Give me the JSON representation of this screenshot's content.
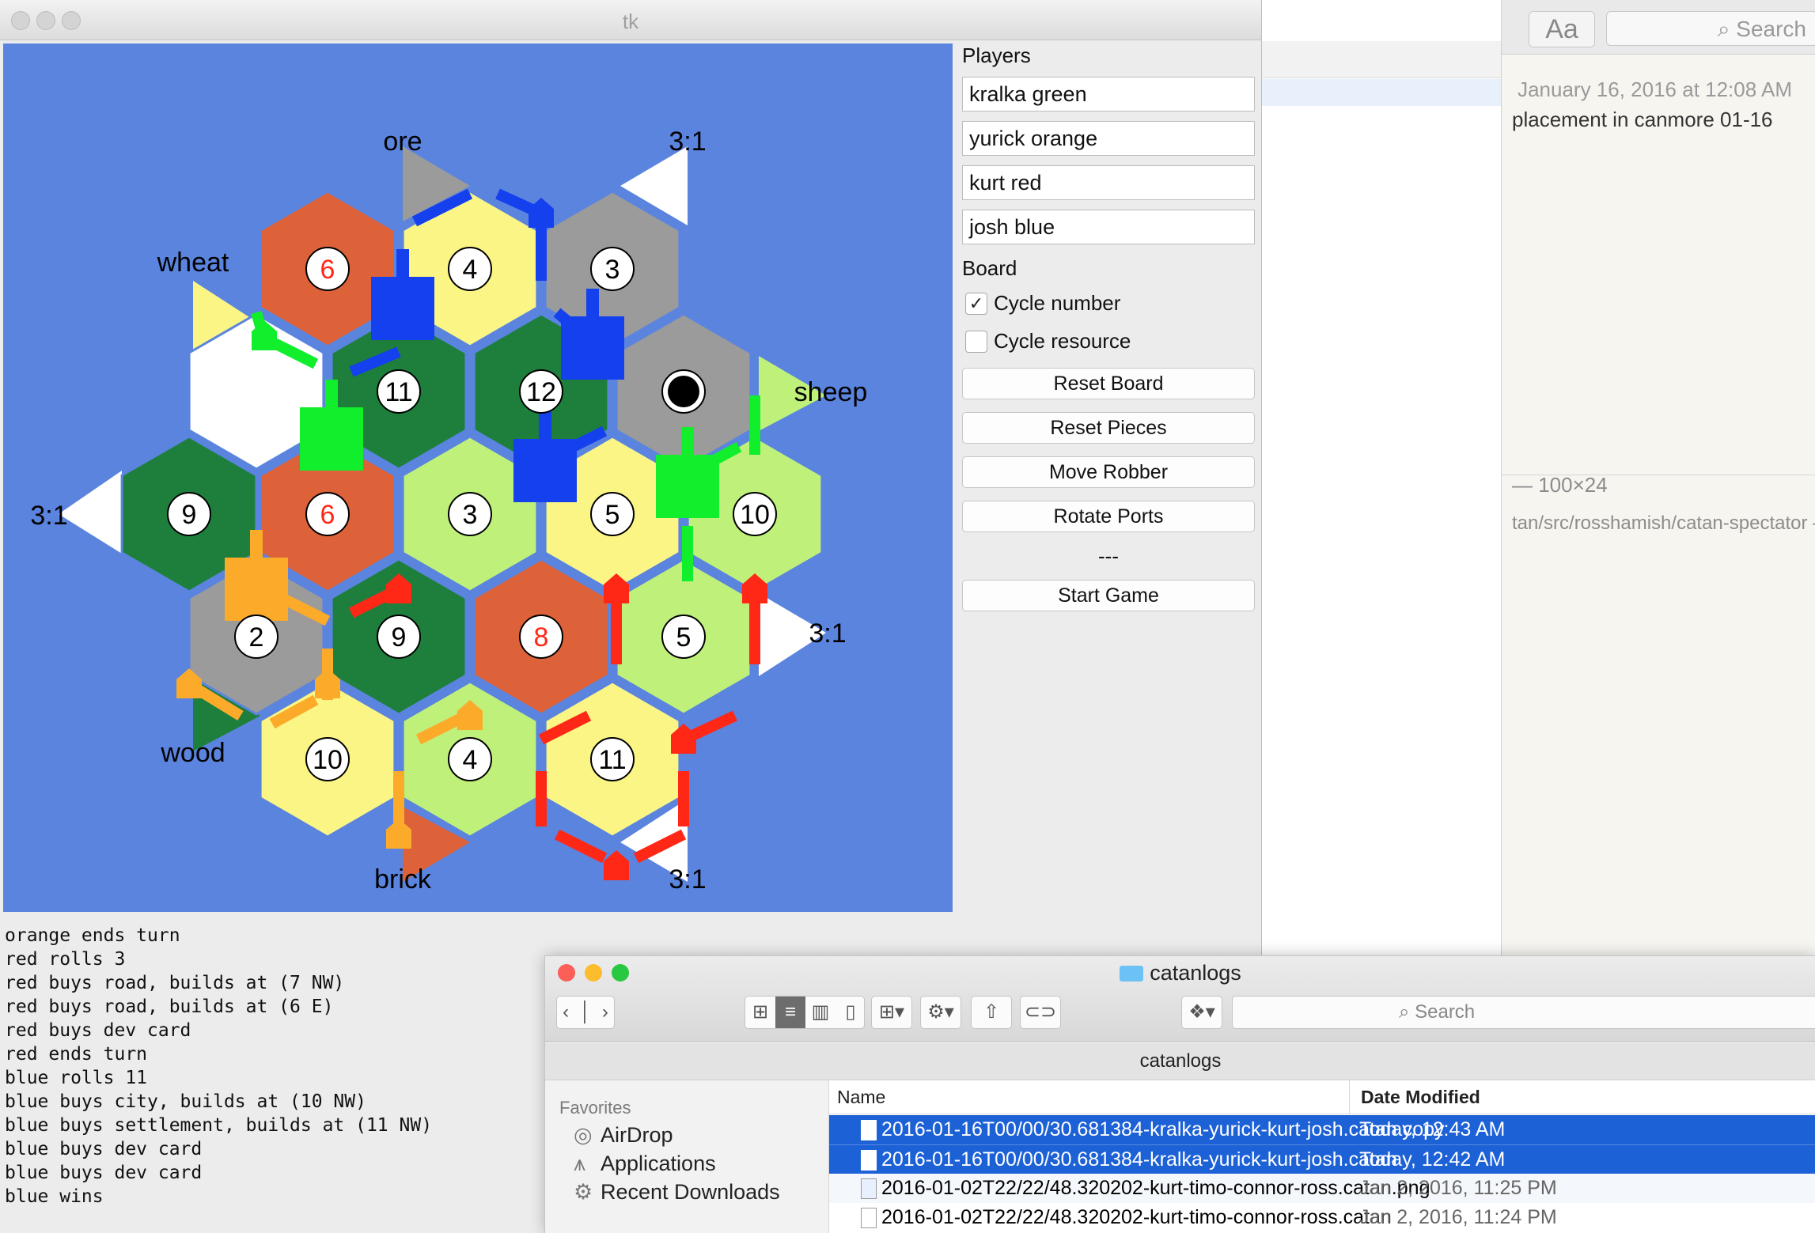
{
  "notes": {
    "font_button": "Aa",
    "search_placeholder": "Search",
    "date": "January 16, 2016 at 12:08 AM",
    "title_fragment": "placement in canmore 01-16",
    "dims": "— 100×24",
    "path_fragment": "tan/src/rosshamish/catan-spectator —"
  },
  "tk": {
    "title": "tk",
    "players_label": "Players",
    "players": [
      "kralka green",
      "yurick orange",
      "kurt red",
      "josh blue"
    ],
    "board_label": "Board",
    "cycle_number": {
      "label": "Cycle number",
      "checked": true
    },
    "cycle_resource": {
      "label": "Cycle resource",
      "checked": false
    },
    "buttons": {
      "reset_board": "Reset Board",
      "reset_pieces": "Reset Pieces",
      "move_robber": "Move Robber",
      "rotate_ports": "Rotate Ports",
      "separator": "---",
      "start_game": "Start Game"
    },
    "log": [
      "orange ends turn",
      "red rolls 3",
      "red buys road, builds at (7 NW)",
      "red buys road, builds at (6 E)",
      "red buys dev card",
      "red ends turn",
      "blue rolls 11",
      "blue buys city, builds at (10 NW)",
      "blue buys settlement, builds at (11 NW)",
      "blue buys dev card",
      "blue buys dev card",
      "blue wins"
    ]
  },
  "board": {
    "colors": {
      "ocean": "#5a84de",
      "wheat": "#fbf586",
      "sheep": "#bff07a",
      "wood": "#1e7f3c",
      "brick": "#dd6239",
      "ore": "#9b9b9b",
      "desert": "#ffffff",
      "green_player": "#10ee2c",
      "orange_player": "#fbaa2a",
      "red_player": "#ff2716",
      "blue_player": "#1440ee"
    },
    "tiles": [
      {
        "row": 0,
        "col": 0,
        "terrain": "brick",
        "number": "6",
        "hot": true
      },
      {
        "row": 0,
        "col": 1,
        "terrain": "wheat",
        "number": "4"
      },
      {
        "row": 0,
        "col": 2,
        "terrain": "ore",
        "number": "3"
      },
      {
        "row": 1,
        "col": 0,
        "terrain": "desert",
        "number": ""
      },
      {
        "row": 1,
        "col": 1,
        "terrain": "wood",
        "number": "11"
      },
      {
        "row": 1,
        "col": 2,
        "terrain": "wood",
        "number": "12"
      },
      {
        "row": 1,
        "col": 3,
        "terrain": "ore",
        "number": "",
        "robber": true
      },
      {
        "row": 2,
        "col": 0,
        "terrain": "wood",
        "number": "9"
      },
      {
        "row": 2,
        "col": 1,
        "terrain": "brick",
        "number": "6",
        "hot": true
      },
      {
        "row": 2,
        "col": 2,
        "terrain": "sheep",
        "number": "3"
      },
      {
        "row": 2,
        "col": 3,
        "terrain": "wheat",
        "number": "5"
      },
      {
        "row": 2,
        "col": 4,
        "terrain": "sheep",
        "number": "10"
      },
      {
        "row": 3,
        "col": 0,
        "terrain": "ore",
        "number": "2"
      },
      {
        "row": 3,
        "col": 1,
        "terrain": "wood",
        "number": "9"
      },
      {
        "row": 3,
        "col": 2,
        "terrain": "brick",
        "number": "8",
        "hot": true
      },
      {
        "row": 3,
        "col": 3,
        "terrain": "sheep",
        "number": "5"
      },
      {
        "row": 4,
        "col": 0,
        "terrain": "wheat",
        "number": "10"
      },
      {
        "row": 4,
        "col": 1,
        "terrain": "sheep",
        "number": "4"
      },
      {
        "row": 4,
        "col": 2,
        "terrain": "wheat",
        "number": "11"
      }
    ],
    "ports": [
      "ore",
      "3:1",
      "wheat",
      "sheep",
      "3:1",
      "3:1",
      "wood",
      "brick",
      "3:1"
    ]
  },
  "finder": {
    "title": "catanlogs",
    "path_title": "catanlogs",
    "search_placeholder": "Search",
    "favorites_label": "Favorites",
    "sidebar": [
      {
        "label": "AirDrop",
        "icon": "airdrop-icon"
      },
      {
        "label": "Applications",
        "icon": "applications-icon"
      },
      {
        "label": "Recent Downloads",
        "icon": "gear-icon"
      }
    ],
    "columns": {
      "name": "Name",
      "date": "Date Modified"
    },
    "files": [
      {
        "name": "2016-01-16T00/00/30.681384-kralka-yurick-kurt-josh.catan copy",
        "date": "Today, 12:43 AM",
        "selected": true
      },
      {
        "name": "2016-01-16T00/00/30.681384-kralka-yurick-kurt-josh.catan",
        "date": "Today, 12:42 AM",
        "selected": true
      },
      {
        "name": "2016-01-02T22/22/48.320202-kurt-timo-connor-ross.catan.png",
        "date": "Jan 2, 2016, 11:25 PM",
        "selected": false
      },
      {
        "name": "2016-01-02T22/22/48.320202-kurt-timo-connor-ross.catan",
        "date": "Jan 2, 2016, 11:24 PM",
        "selected": false
      }
    ]
  }
}
